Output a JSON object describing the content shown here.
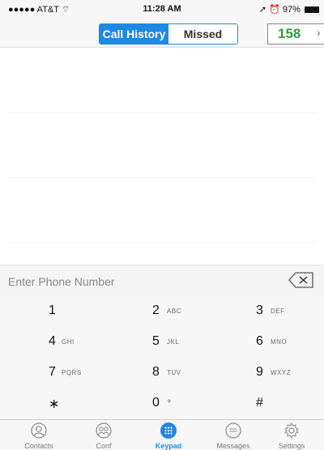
{
  "status_bar": {
    "carrier": "●●●●● AT&T",
    "time": "11:28 AM",
    "battery": "97%"
  },
  "header": {
    "tabs": [
      {
        "label": "Call History"
      },
      {
        "label": "Missed"
      }
    ],
    "counter": "158"
  },
  "entry": {
    "placeholder": "Enter Phone Number"
  },
  "keypad": {
    "keys": [
      {
        "digit": "1",
        "letters": ""
      },
      {
        "digit": "2",
        "letters": "ABC"
      },
      {
        "digit": "3",
        "letters": "DEF"
      },
      {
        "digit": "4",
        "letters": "GHI"
      },
      {
        "digit": "5",
        "letters": "JKL"
      },
      {
        "digit": "6",
        "letters": "MNO"
      },
      {
        "digit": "7",
        "letters": "PQRS"
      },
      {
        "digit": "8",
        "letters": "TUV"
      },
      {
        "digit": "9",
        "letters": "WXYZ"
      },
      {
        "digit": "∗",
        "letters": ""
      },
      {
        "digit": "0",
        "letters": "+"
      },
      {
        "digit": "#",
        "letters": ""
      }
    ]
  },
  "tab_bar": {
    "items": [
      {
        "label": "Contacts",
        "icon": "contacts-icon"
      },
      {
        "label": "Conf",
        "icon": "conference-icon"
      },
      {
        "label": "Keypad",
        "icon": "keypad-icon"
      },
      {
        "label": "Messages",
        "icon": "messages-icon"
      },
      {
        "label": "Settings",
        "icon": "settings-icon"
      }
    ],
    "active": "Keypad"
  },
  "colors": {
    "accent": "#1e88e5",
    "counter": "#2e9e3a"
  }
}
